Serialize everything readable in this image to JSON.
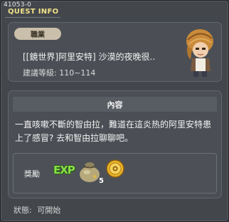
{
  "header": {
    "quest_id": "41053-0",
    "title": "QUEST INFO"
  },
  "summary": {
    "job_tag": "職業",
    "quest_name": "[[鏡世界]阿里安特] 沙漠的夜晚很..",
    "level_text": "建議等級: 110~114"
  },
  "content": {
    "header": "內容",
    "body": "一直咳嗽不斷的智由拉，難道在這炎热的阿里安特患上了感冒? 去和智由拉聊聊吧。"
  },
  "reward": {
    "label": "獎勵",
    "exp_label": "EXP",
    "item_count": "5"
  },
  "status": {
    "label": "狀態:",
    "value": "可開始"
  },
  "colors": {
    "title": "#f1e28a",
    "panel": "#4b4f55",
    "window": "#43464b",
    "exp": "#88e04a"
  }
}
